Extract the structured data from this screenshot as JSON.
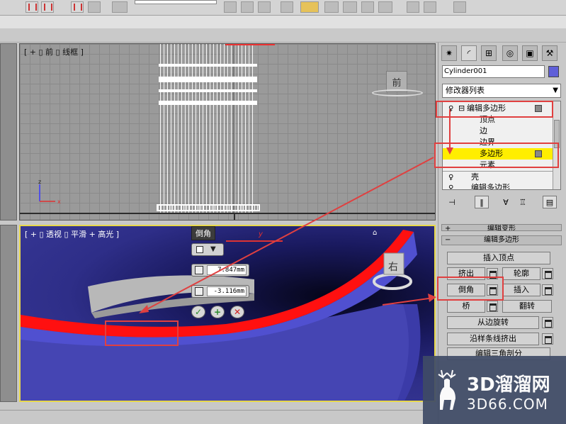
{
  "front_viewport": {
    "label": "[ + ▯ 前 ▯ 线框 ]",
    "viewcube_face": "前",
    "axis_z": "z",
    "axis_x": "x"
  },
  "persp_viewport": {
    "label": "[ + ▯ 透视 ▯ 平滑 + 高光 ]",
    "viewcube_face": "右"
  },
  "caddy": {
    "title": "倒角",
    "height_value": "7.847mm",
    "outline_value": "-3.116mm",
    "axis_y": "y",
    "ok_icon": "checkmark-icon",
    "apply_icon": "plus-icon",
    "cancel_icon": "x-icon"
  },
  "panel": {
    "object_name": "Cylinder001",
    "object_color": "#5f5fd8",
    "modifier_list": "修改器列表",
    "stack": {
      "item1": "编辑多边形",
      "sub_vertex": "顶点",
      "sub_edge": "边",
      "sub_border": "边界",
      "sub_polygon": "多边形",
      "sub_element": "元素",
      "item2": "壳",
      "item3": "编辑多边形"
    },
    "rollouts": {
      "top_cut": "编辑变形",
      "edit_poly": "编辑多边形"
    },
    "buttons": {
      "insert_vertex": "插入顶点",
      "extrude": "挤出",
      "outline": "轮廓",
      "bevel": "倒角",
      "inset": "插入",
      "bridge": "桥",
      "flip": "翻转",
      "hinge": "从边旋转",
      "extrude_spline": "沿样条线挤出",
      "edit_tri": "编辑三角剖分"
    }
  },
  "watermark": {
    "line1": "3D溜溜网",
    "line2": "3D66.COM"
  },
  "highlight_color": "#e04040",
  "selection_color": "#ffee00"
}
